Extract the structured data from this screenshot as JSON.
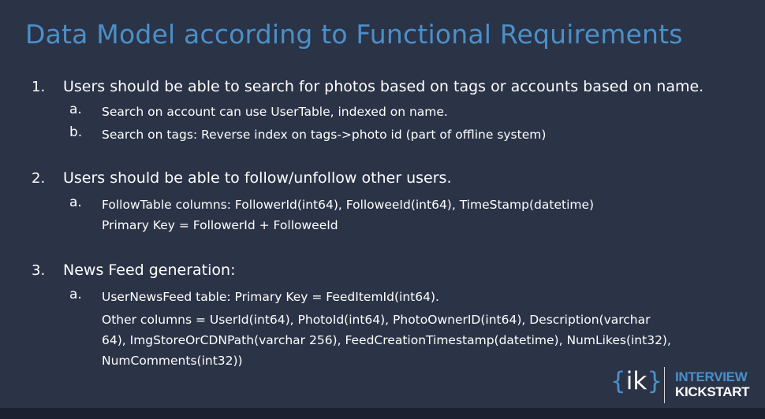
{
  "slide": {
    "title": "Data Model according to Functional Requirements",
    "items": [
      {
        "number": "1.",
        "text": "Users should be able to search for photos based on tags or accounts based on name.",
        "subitems": [
          {
            "letter": "a.",
            "lines": [
              "Search on account can use UserTable, indexed on name."
            ]
          },
          {
            "letter": "b.",
            "lines": [
              "Search on tags: Reverse index on tags->photo id (part of offline system)"
            ]
          }
        ]
      },
      {
        "number": "2.",
        "text": "Users should be able to follow/unfollow other users.",
        "subitems": [
          {
            "letter": "a.",
            "lines": [
              "FollowTable columns: FollowerId(int64), FolloweeId(int64), TimeStamp(datetime)",
              "Primary Key = FollowerId + FolloweeId"
            ]
          }
        ]
      },
      {
        "number": "3.",
        "text": "News Feed generation:",
        "subitems": [
          {
            "letter": "a.",
            "lines": [
              "UserNewsFeed table: Primary Key = FeedItemId(int64).",
              "Other columns = UserId(int64), PhotoId(int64), PhotoOwnerID(int64), Description(varchar",
              "64), ImgStoreOrCDNPath(varchar 256), FeedCreationTimestamp(datetime), NumLikes(int32),",
              "NumComments(int32))"
            ]
          }
        ]
      }
    ]
  },
  "logo": {
    "mark_open": "{",
    "mark_text": "ik",
    "mark_close": "}",
    "line1": "INTERVIEW",
    "line2": "KICKSTART"
  }
}
